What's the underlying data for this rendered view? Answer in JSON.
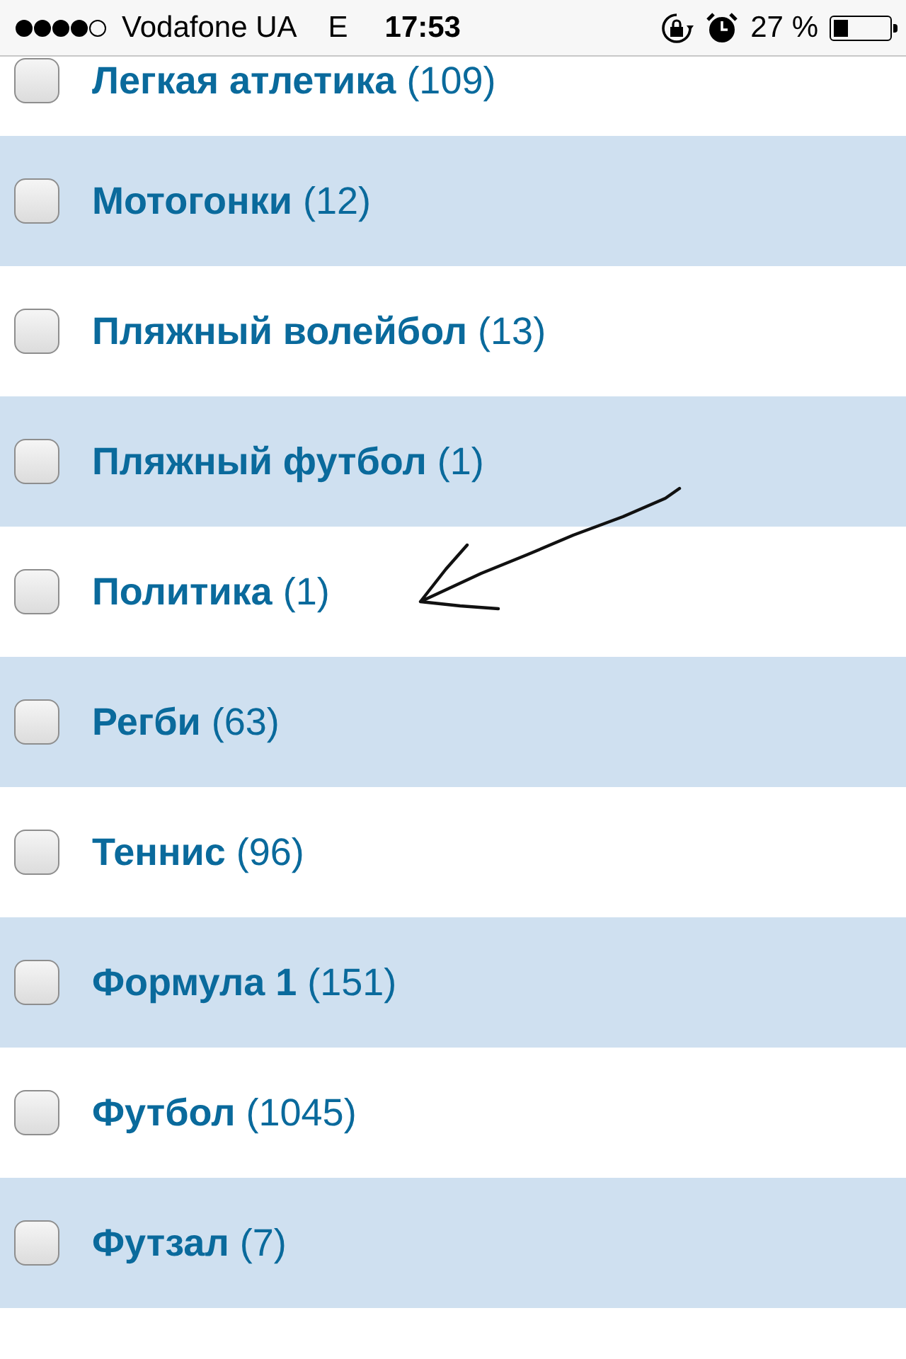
{
  "status_bar": {
    "carrier": "Vodafone UA",
    "network": "E",
    "time": "17:53",
    "battery": "27 %"
  },
  "items": [
    {
      "name": "Легкая атлетика",
      "count": "(109)",
      "checked": false
    },
    {
      "name": "Мотогонки",
      "count": "(12)",
      "checked": false
    },
    {
      "name": "Пляжный волейбол",
      "count": "(13)",
      "checked": false
    },
    {
      "name": "Пляжный футбол",
      "count": "(1)",
      "checked": false
    },
    {
      "name": "Политика",
      "count": "(1)",
      "checked": false
    },
    {
      "name": "Регби",
      "count": "(63)",
      "checked": false
    },
    {
      "name": "Теннис",
      "count": "(96)",
      "checked": false
    },
    {
      "name": "Формула 1",
      "count": "(151)",
      "checked": false
    },
    {
      "name": "Футбол",
      "count": "(1045)",
      "checked": false
    },
    {
      "name": "Футзал",
      "count": "(7)",
      "checked": false
    }
  ]
}
